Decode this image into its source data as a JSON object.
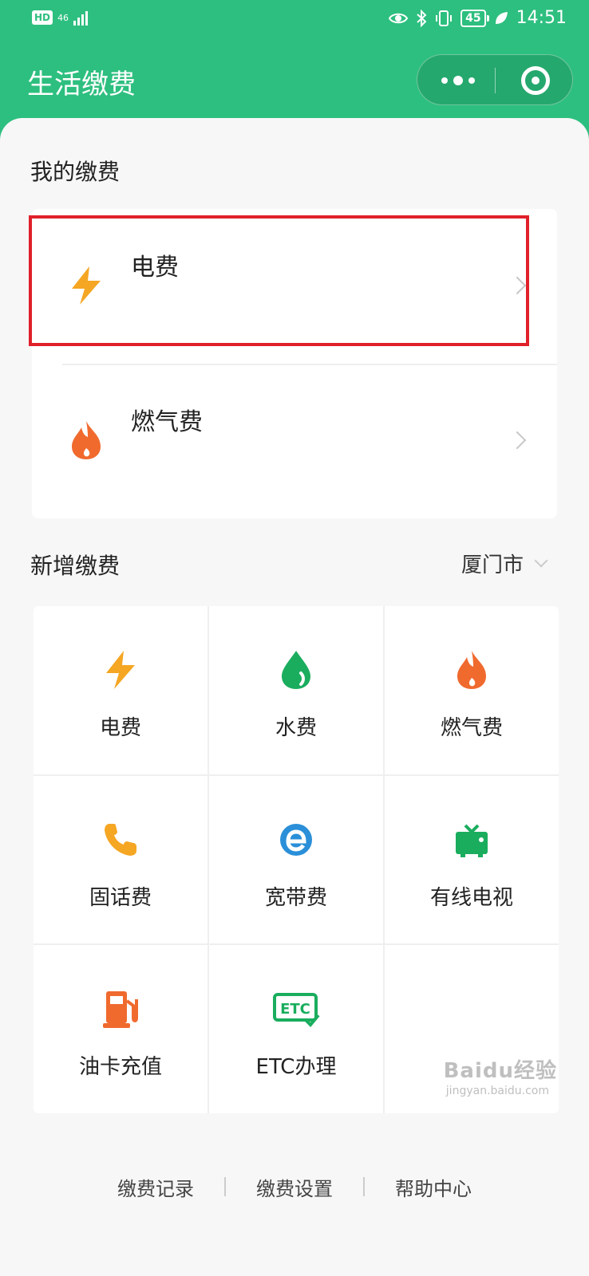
{
  "status_bar": {
    "hd": "HD",
    "network": "46",
    "battery": "45",
    "time": "14:51"
  },
  "nav": {
    "title": "生活缴费"
  },
  "my_payments": {
    "title": "我的缴费",
    "items": [
      {
        "label": "电费",
        "icon": "lightning-icon"
      },
      {
        "label": "燃气费",
        "icon": "flame-icon"
      }
    ]
  },
  "new_payments": {
    "title": "新增缴费",
    "city": "厦门市",
    "grid": [
      {
        "label": "电费",
        "icon": "lightning-icon"
      },
      {
        "label": "水费",
        "icon": "water-drop-icon"
      },
      {
        "label": "燃气费",
        "icon": "flame-icon"
      },
      {
        "label": "固话费",
        "icon": "phone-icon"
      },
      {
        "label": "宽带费",
        "icon": "broadband-icon"
      },
      {
        "label": "有线电视",
        "icon": "tv-icon"
      },
      {
        "label": "油卡充值",
        "icon": "fuel-pump-icon"
      },
      {
        "label": "ETC办理",
        "icon": "etc-icon"
      }
    ]
  },
  "footer": {
    "links": [
      "缴费记录",
      "缴费设置",
      "帮助中心"
    ]
  },
  "watermark": {
    "text": "Baidu经验",
    "sub": "jingyan.baidu.com"
  },
  "colors": {
    "brand_green": "#2dbf7f",
    "lightning": "#f5a623",
    "flame": "#f06a2e",
    "water": "#1aad5e",
    "broadband": "#2a8fd8",
    "highlight": "#e0202a"
  }
}
